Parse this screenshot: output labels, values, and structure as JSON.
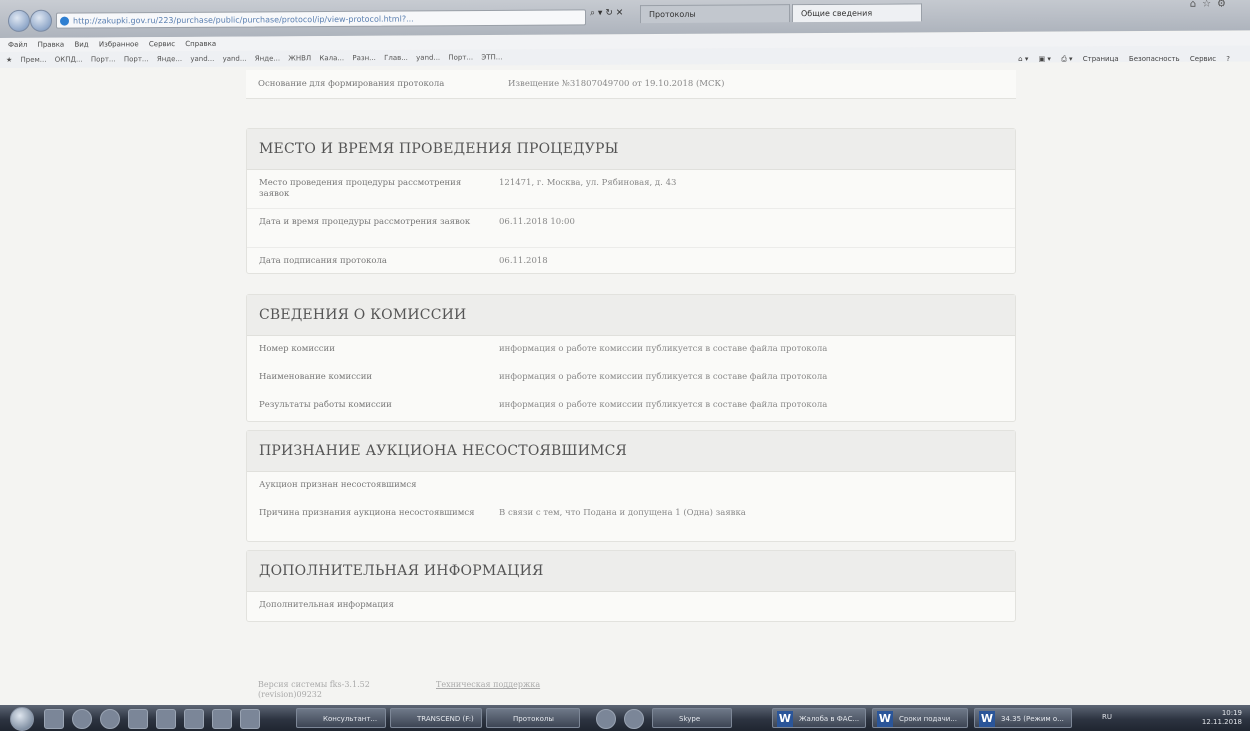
{
  "browser": {
    "address": "http://zakupki.gov.ru/223/purchase/public/purchase/protocol/ip/view-protocol.html?...",
    "tabs": [
      "Протоколы",
      "Общие сведения"
    ],
    "menu": [
      "Файл",
      "Правка",
      "Вид",
      "Избранное",
      "Сервис",
      "Справка"
    ],
    "favorites": [
      "Прем...",
      "ОКПД...",
      "Порт...",
      "Порт...",
      "Янде...",
      "yand...",
      "yand...",
      "Янде...",
      "ЖНВЛ",
      "Кала...",
      "Разн...",
      "Глав...",
      "yand...",
      "Порт...",
      "ЭТП..."
    ],
    "command_bar": [
      "Страница",
      "Безопасность",
      "Сервис"
    ]
  },
  "basis_row": {
    "label": "Основание для формирования протокола",
    "value": "Извещение №31807049700 от 19.10.2018 (МСК)"
  },
  "sections": {
    "place_time": {
      "title": "МЕСТО И ВРЕМЯ ПРОВЕДЕНИЯ ПРОЦЕДУРЫ",
      "rows": [
        {
          "label": "Место проведения процедуры рассмотрения заявок",
          "value": "121471, г. Москва, ул. Рябиновая, д. 43"
        },
        {
          "label": "Дата и время процедуры рассмотрения заявок",
          "value": "06.11.2018 10:00"
        },
        {
          "label": "Дата подписания протокола",
          "value": "06.11.2018"
        }
      ]
    },
    "commission": {
      "title": "СВЕДЕНИЯ О КОМИССИИ",
      "rows": [
        {
          "label": "Номер комиссии",
          "value": "информация о работе комиссии публикуется в составе файла протокола"
        },
        {
          "label": "Наименование комиссии",
          "value": "информация о работе комиссии публикуется в составе файла протокола"
        },
        {
          "label": "Результаты работы комиссии",
          "value": "информация о работе комиссии публикуется в составе файла протокола"
        }
      ]
    },
    "failed": {
      "title": "ПРИЗНАНИЕ АУКЦИОНА НЕСОСТОЯВШИМСЯ",
      "rows": [
        {
          "label": "Аукцион признан несостоявшимся",
          "value": ""
        },
        {
          "label": "Причина признания аукциона несостоявшимся",
          "value": "В связи с тем, что Подана и допущена 1 (Одна) заявка"
        }
      ]
    },
    "additional": {
      "title": "ДОПОЛНИТЕЛЬНАЯ ИНФОРМАЦИЯ",
      "rows": [
        {
          "label": "Дополнительная информация",
          "value": ""
        }
      ]
    }
  },
  "footer": {
    "version": "Версия системы fks-3.1.52",
    "revision": "(revision)09232",
    "support": "Техническая поддержка"
  },
  "taskbar": {
    "items": [
      "Консультант...",
      "TRANSCEND (F:)",
      "Протоколы",
      "Skype",
      "Жалоба в ФАС...",
      "Сроки подачи...",
      "34.35 (Режим о..."
    ],
    "lang": "RU",
    "time": "10:19",
    "date": "12.11.2018"
  }
}
